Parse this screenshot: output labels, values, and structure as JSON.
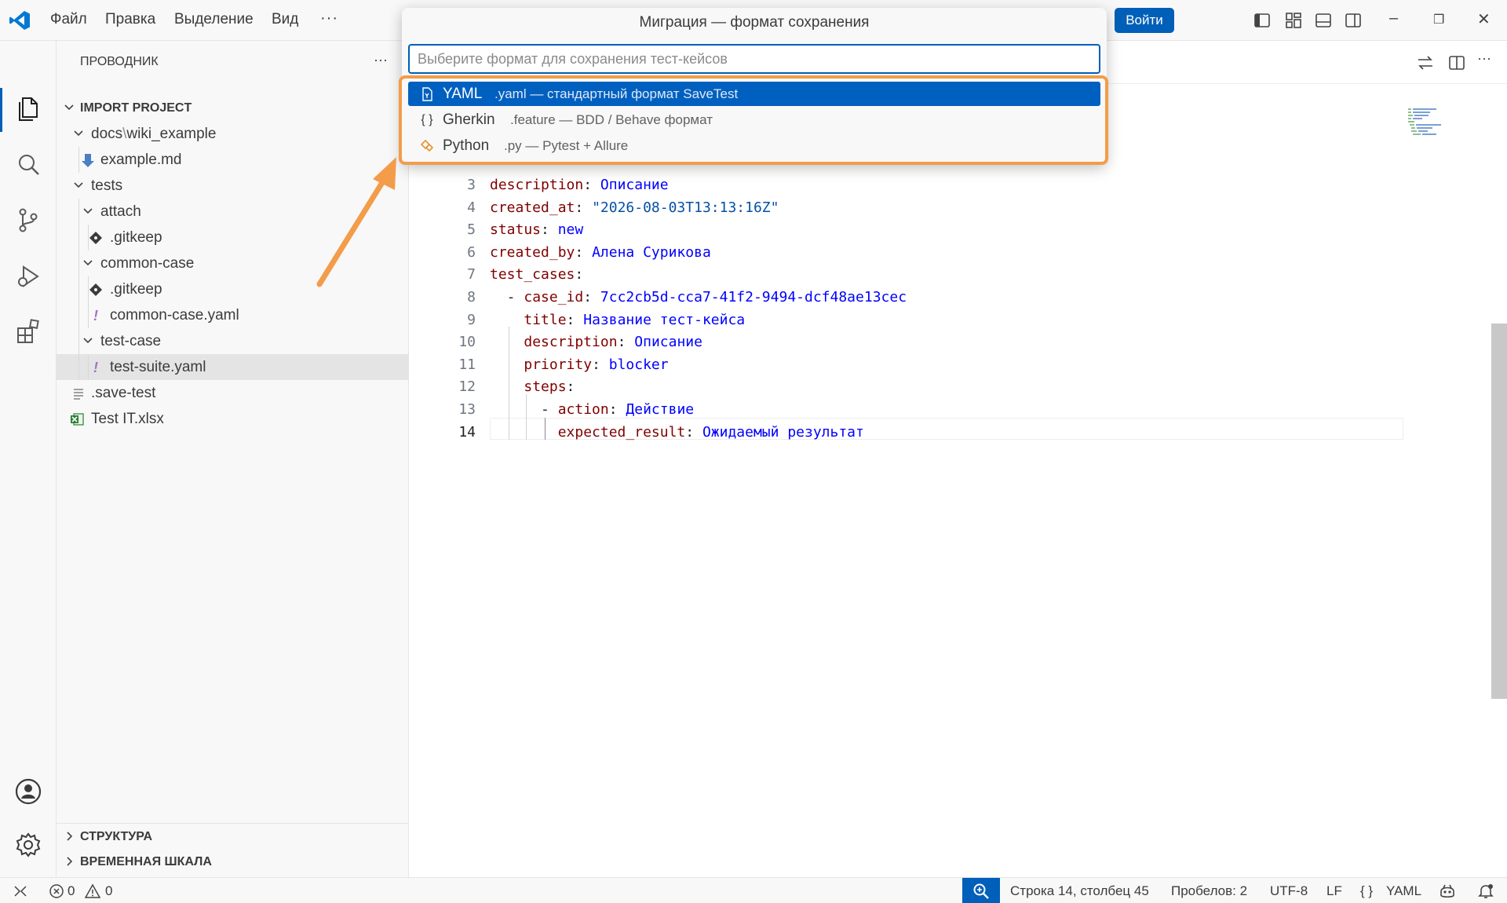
{
  "titlebar": {
    "menu": [
      "Файл",
      "Правка",
      "Выделение",
      "Вид"
    ],
    "more": "···",
    "signin": "Войти",
    "controls": {
      "minimize": "–",
      "restore": "❐",
      "close": "✕"
    }
  },
  "sidebar": {
    "title": "ПРОВОДНИК",
    "more": "···",
    "tree": [
      {
        "label": "IMPORT PROJECT",
        "bold": true
      },
      {
        "label": "docs",
        "sep": "\\",
        "label2": "wiki_example"
      },
      {
        "label": "example.md"
      },
      {
        "label": "tests"
      },
      {
        "label": "attach"
      },
      {
        "label": ".gitkeep"
      },
      {
        "label": "common-case"
      },
      {
        "label": ".gitkeep"
      },
      {
        "label": "common-case.yaml"
      },
      {
        "label": "test-case"
      },
      {
        "label": "test-suite.yaml"
      },
      {
        "label": ".save-test"
      },
      {
        "label": "Test IT.xlsx"
      }
    ],
    "sections": [
      "СТРУКТУРА",
      "ВРЕМЕННАЯ ШКАЛА"
    ]
  },
  "quickpick": {
    "title": "Миграция — формат сохранения",
    "placeholder": "Выберите формат для сохранения тест-кейсов",
    "value": "",
    "items": [
      {
        "label": "YAML",
        "desc": ".yaml — стандартный формат SaveTest",
        "icon": "yaml-file-icon",
        "active": true
      },
      {
        "label": "Gherkin",
        "desc": ".feature — BDD / Behave формат",
        "icon": "braces-icon",
        "active": false
      },
      {
        "label": "Python",
        "desc": ".py — Pytest + Allure",
        "icon": "python-icon",
        "active": false
      }
    ]
  },
  "editor": {
    "lines": [
      {
        "n": "3",
        "indent": "",
        "key": "description",
        "val": "Описание"
      },
      {
        "n": "4",
        "indent": "",
        "key": "created_at",
        "val": "\"2026-08-03T13:13:16Z\"",
        "str": true
      },
      {
        "n": "5",
        "indent": "",
        "key": "status",
        "val": "new"
      },
      {
        "n": "6",
        "indent": "",
        "key": "created_by",
        "val": "Алена Сурикова"
      },
      {
        "n": "7",
        "indent": "",
        "key": "test_cases",
        "val": ""
      },
      {
        "n": "8",
        "indent": "  - ",
        "key": "case_id",
        "val": "7cc2cb5d-cca7-41f2-9494-dcf48ae13cec"
      },
      {
        "n": "9",
        "indent": "    ",
        "key": "title",
        "val": "Название тест-кейса"
      },
      {
        "n": "10",
        "indent": "    ",
        "key": "description",
        "val": "Описание"
      },
      {
        "n": "11",
        "indent": "    ",
        "key": "priority",
        "val": "blocker"
      },
      {
        "n": "12",
        "indent": "    ",
        "key": "steps",
        "val": ""
      },
      {
        "n": "13",
        "indent": "      - ",
        "key": "action",
        "val": "Действие"
      },
      {
        "n": "14",
        "indent": "        ",
        "key": "expected_result",
        "val": "Ожидаемый результат",
        "current": true
      }
    ]
  },
  "statusbar": {
    "errors": "0",
    "warnings": "0",
    "position": "Строка 14, столбец 45",
    "spaces": "Пробелов: 2",
    "encoding": "UTF-8",
    "eol": "LF",
    "lang_braces": "{ }",
    "language": "YAML"
  },
  "colors": {
    "accent": "#005fb8",
    "highlight_box": "#f39c4a",
    "yaml_key": "#800000",
    "yaml_value": "#0000ff"
  }
}
